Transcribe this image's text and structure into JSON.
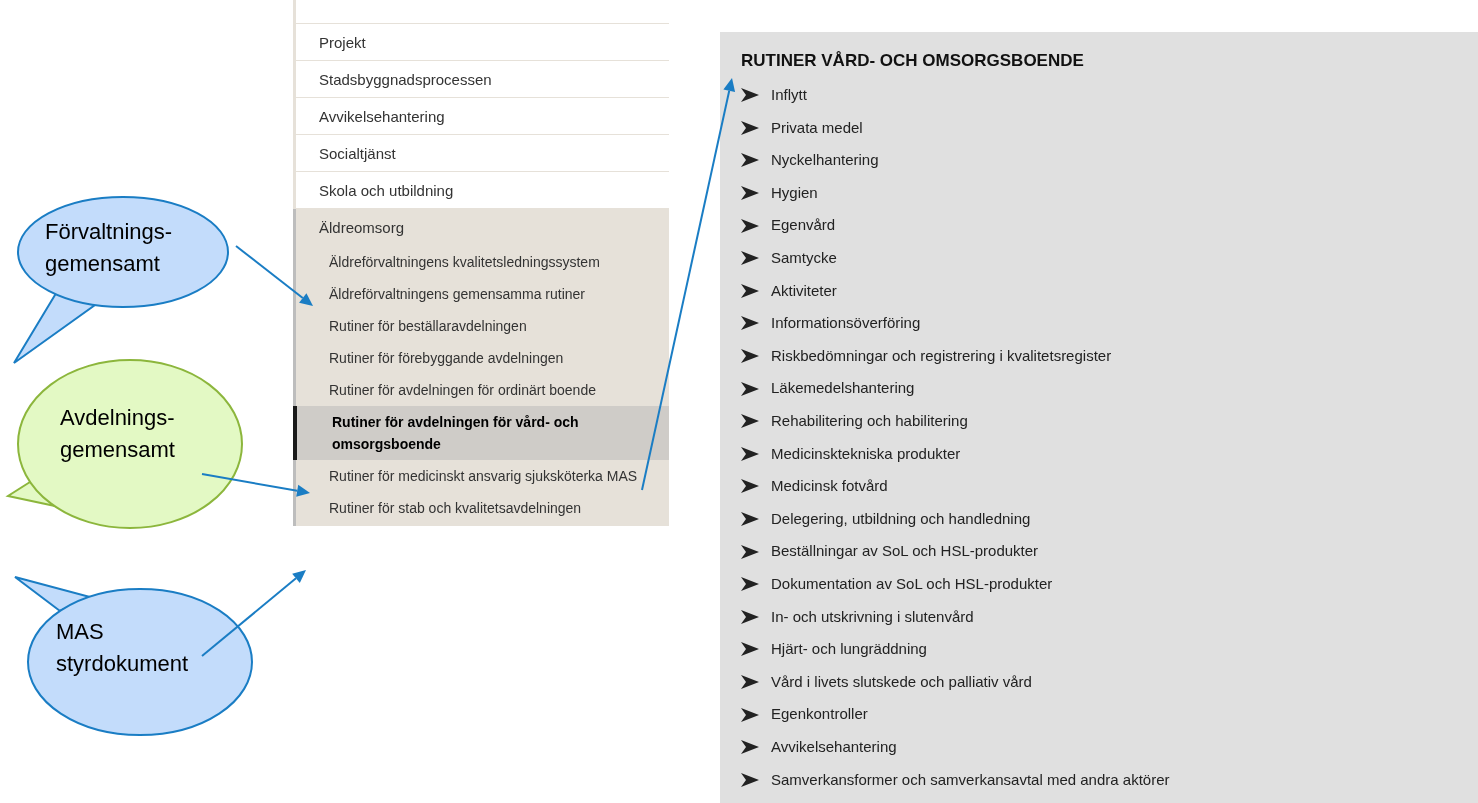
{
  "menu": {
    "items": [
      {
        "label": "Projekt"
      },
      {
        "label": "Stadsbyggnadsprocessen"
      },
      {
        "label": "Avvikelsehantering"
      },
      {
        "label": "Socialtjänst"
      },
      {
        "label": "Skola och utbildning"
      },
      {
        "label": "Äldreomsorg",
        "expanded": true,
        "children": [
          {
            "label": "Äldreförvaltningens kvalitetsledningssystem",
            "selected": false
          },
          {
            "label": "Äldreförvaltningens gemensamma rutiner",
            "selected": false
          },
          {
            "label": "Rutiner för beställaravdelningen",
            "selected": false
          },
          {
            "label": "Rutiner för förebyggande avdelningen",
            "selected": false
          },
          {
            "label": "Rutiner för avdelningen för ordinärt boende",
            "selected": false
          },
          {
            "label": "Rutiner för avdelningen för vård- och omsorgsboende",
            "selected": true
          },
          {
            "label": "Rutiner för medicinskt ansvarig sjuksköterka MAS",
            "selected": false
          },
          {
            "label": "Rutiner för stab och kvalitetsavdelningen",
            "selected": false
          }
        ]
      }
    ]
  },
  "panel": {
    "title": "RUTINER VÅRD- OCH OMSORGSBOENDE",
    "items": [
      "Inflytt",
      "Privata medel",
      "Nyckelhantering",
      "Hygien",
      "Egenvård",
      "Samtycke",
      "Aktiviteter",
      "Informationsöverföring",
      "Riskbedömningar och registrering i kvalitetsregister",
      "Läkemedelshantering",
      "Rehabilitering och habilitering",
      "Medicinsktekniska produkter",
      "Medicinsk fotvård",
      "Delegering, utbildning och handledning",
      "Beställningar av SoL och HSL-produkter",
      "Dokumentation av SoL och HSL-produkter",
      "In- och utskrivning i slutenvård",
      "Hjärt- och lungräddning",
      "Vård i livets slutskede och palliativ vård",
      "Egenkontroller",
      "Avvikelsehantering",
      "Samverkansformer och samverkansavtal med andra aktörer"
    ]
  },
  "callouts": [
    {
      "lines": [
        "Förvaltnings-",
        "gemensamt"
      ],
      "color": "#c3dcfb"
    },
    {
      "lines": [
        "Avdelnings-",
        "gemensamt"
      ],
      "color": "#e3f9c4"
    },
    {
      "lines": [
        "MAS",
        "styrdokument"
      ],
      "color": "#c3dcfb"
    }
  ]
}
